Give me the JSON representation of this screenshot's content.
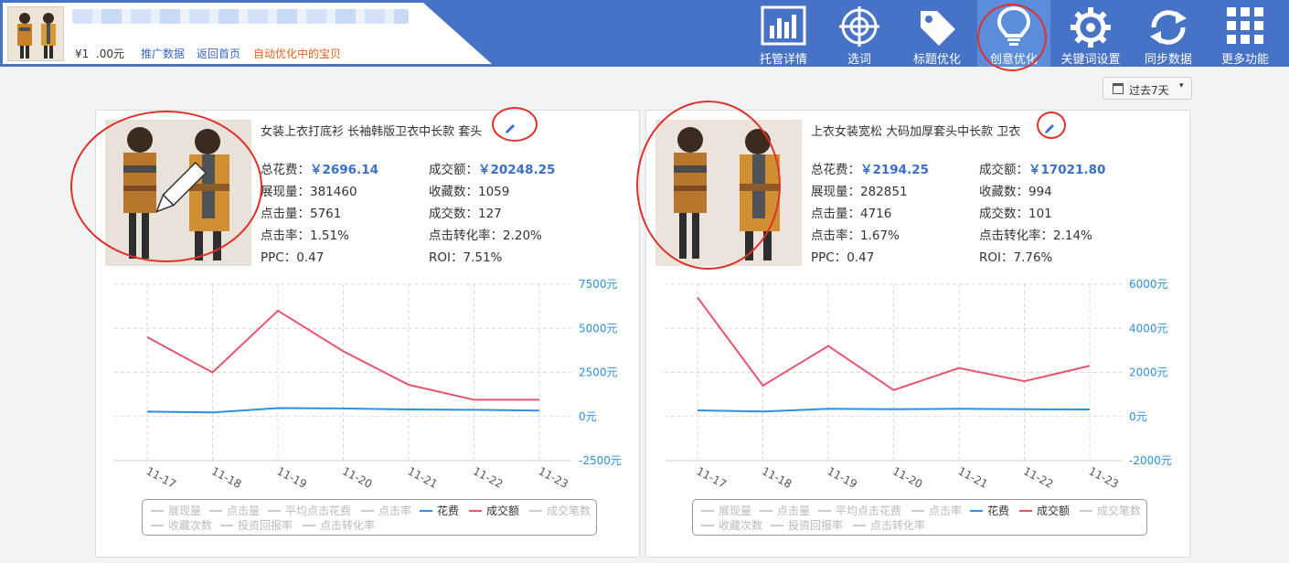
{
  "header": {
    "price": "¥1  .00元",
    "links": [
      "推广数据",
      "返回首页",
      "自动优化中的宝贝"
    ]
  },
  "nav": [
    {
      "label": "托管详情",
      "icon": "bar-chart-icon"
    },
    {
      "label": "选词",
      "icon": "target-icon"
    },
    {
      "label": "标题优化",
      "icon": "tag-icon"
    },
    {
      "label": "创意优化",
      "icon": "lightbulb-icon",
      "active": true
    },
    {
      "label": "关键词设置",
      "icon": "gear-icon"
    },
    {
      "label": "同步数据",
      "icon": "sync-icon"
    },
    {
      "label": "更多功能",
      "icon": "grid-icon"
    }
  ],
  "date_filter": "过去7天",
  "legend": [
    "展现量",
    "点击量",
    "平均点击花费",
    "点击率",
    "花费",
    "成交额",
    "成交笔数",
    "收藏次数",
    "投资回报率",
    "点击转化率"
  ],
  "colors": {
    "accent": "#4673c5",
    "spend": "#2f8fe0",
    "revenue": "#e8546c",
    "highlight": "#3a6fc8",
    "annotation": "#e0302a"
  },
  "cards": [
    {
      "title": "女装上衣打底衫 长袖韩版卫衣中长款 套头",
      "stats": {
        "total_spend": {
          "label": "总花费：",
          "value": "￥2696.14"
        },
        "revenue": {
          "label": "成交额：",
          "value": "￥20248.25"
        },
        "impressions": {
          "label": "展现量：",
          "value": "381460"
        },
        "favorites": {
          "label": "收藏数：",
          "value": "1059"
        },
        "clicks": {
          "label": "点击量：",
          "value": "5761"
        },
        "orders": {
          "label": "成交数：",
          "value": "127"
        },
        "ctr": {
          "label": "点击率：",
          "value": "1.51%"
        },
        "cvr": {
          "label": "点击转化率：",
          "value": "2.20%"
        },
        "ppc": {
          "label": "PPC：",
          "value": "0.47"
        },
        "roi": {
          "label": "ROI：",
          "value": "7.51%"
        }
      }
    },
    {
      "title": "上衣女装宽松 大码加厚套头中长款 卫衣",
      "stats": {
        "total_spend": {
          "label": "总花费：",
          "value": "￥2194.25"
        },
        "revenue": {
          "label": "成交额：",
          "value": "￥17021.80"
        },
        "impressions": {
          "label": "展现量：",
          "value": "282851"
        },
        "favorites": {
          "label": "收藏数：",
          "value": "994"
        },
        "clicks": {
          "label": "点击量：",
          "value": "4716"
        },
        "orders": {
          "label": "成交数：",
          "value": "101"
        },
        "ctr": {
          "label": "点击率：",
          "value": "1.67%"
        },
        "cvr": {
          "label": "点击转化率：",
          "value": "2.14%"
        },
        "ppc": {
          "label": "PPC：",
          "value": "0.47"
        },
        "roi": {
          "label": "ROI：",
          "value": "7.76%"
        }
      }
    }
  ],
  "chart_data": [
    {
      "type": "line",
      "x": [
        "11-17",
        "11-18",
        "11-19",
        "11-20",
        "11-21",
        "11-22",
        "11-23"
      ],
      "yticks": [
        "7500元",
        "5000元",
        "2500元",
        "0元",
        "-2500元"
      ],
      "ylim": [
        -2500,
        7500
      ],
      "series": [
        {
          "name": "成交额",
          "values": [
            4500,
            2500,
            6000,
            3700,
            1800,
            950,
            950
          ]
        },
        {
          "name": "花费",
          "values": [
            280,
            230,
            480,
            460,
            400,
            380,
            340
          ]
        }
      ]
    },
    {
      "type": "line",
      "x": [
        "11-17",
        "11-18",
        "11-19",
        "11-20",
        "11-21",
        "11-22",
        "11-23"
      ],
      "yticks": [
        "6000元",
        "4000元",
        "2000元",
        "0元",
        "-2000元"
      ],
      "ylim": [
        -2000,
        6000
      ],
      "series": [
        {
          "name": "成交额",
          "values": [
            5400,
            1400,
            3200,
            1200,
            2200,
            1600,
            2300
          ]
        },
        {
          "name": "花费",
          "values": [
            280,
            230,
            350,
            330,
            350,
            330,
            320
          ]
        }
      ]
    }
  ]
}
